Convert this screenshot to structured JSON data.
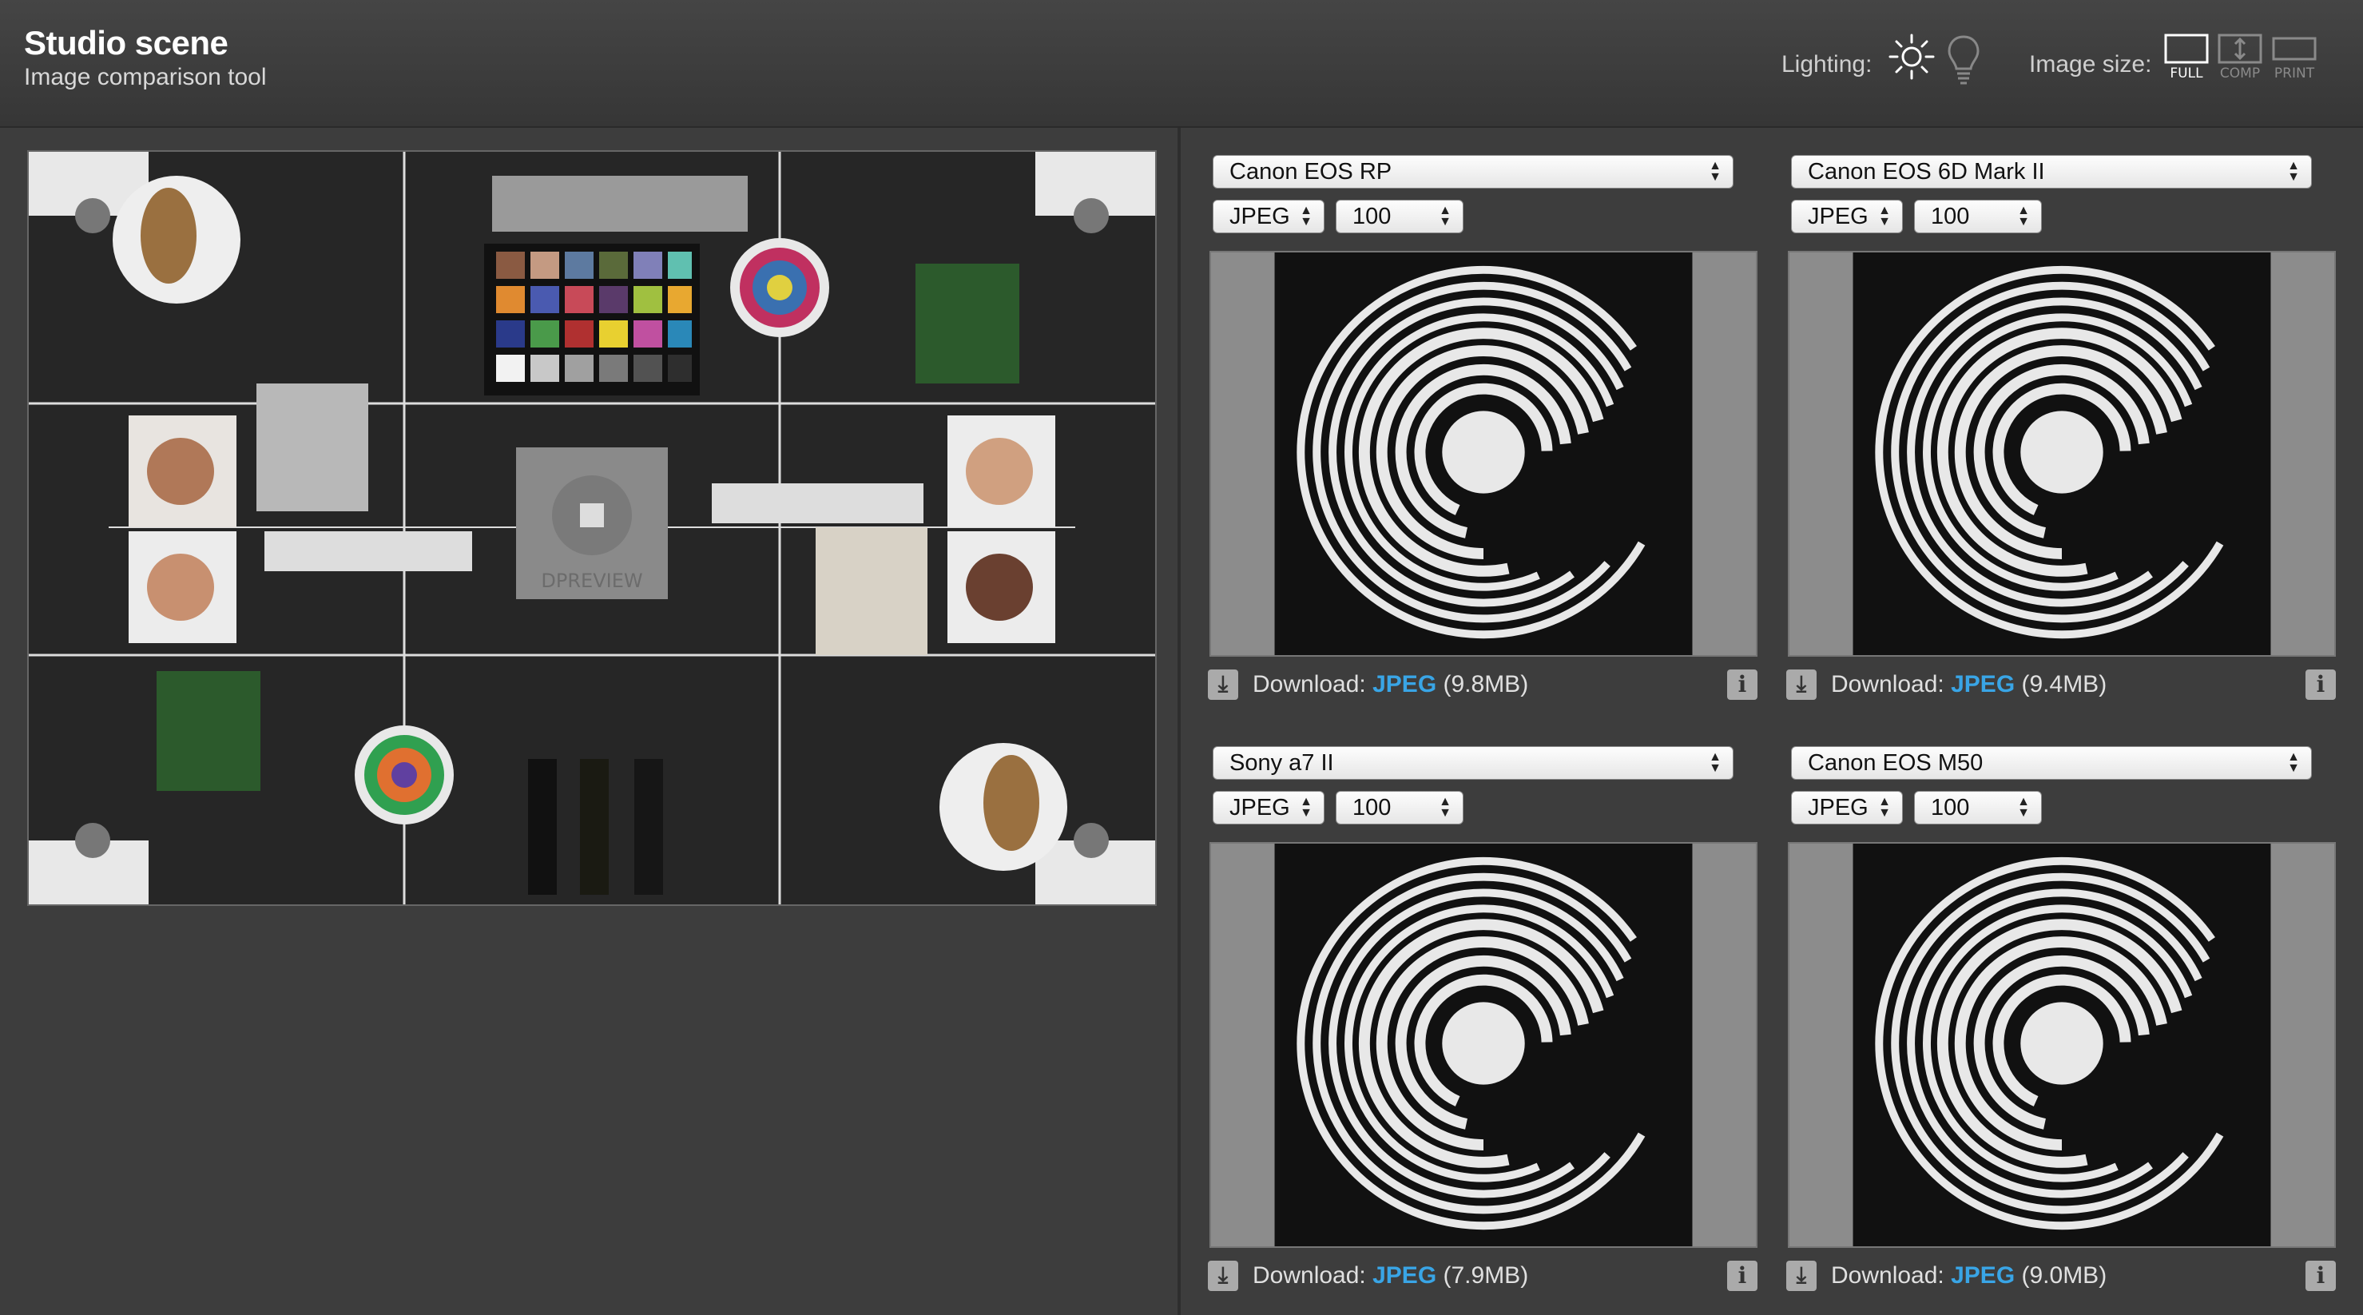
{
  "header": {
    "title": "Studio scene",
    "subtitle": "Image comparison tool",
    "lighting_label": "Lighting:",
    "lighting_options": [
      {
        "icon": "sun-icon",
        "active": true
      },
      {
        "icon": "bulb-icon",
        "active": false
      }
    ],
    "image_size_label": "Image size:",
    "image_size_options": [
      {
        "label": "FULL",
        "active": true
      },
      {
        "label": "COMP",
        "active": false
      },
      {
        "label": "PRINT",
        "active": false
      }
    ]
  },
  "scene": {
    "watermark": "DPREVIEW"
  },
  "panels": [
    {
      "camera": "Canon EOS RP",
      "format": "JPEG",
      "quality": "100",
      "download_label": "Download:",
      "download_format": "JPEG",
      "download_size": "(9.8MB)"
    },
    {
      "camera": "Canon EOS 6D Mark II",
      "format": "JPEG",
      "quality": "100",
      "download_label": "Download:",
      "download_format": "JPEG",
      "download_size": "(9.4MB)"
    },
    {
      "camera": "Sony a7 II",
      "format": "JPEG",
      "quality": "100",
      "download_label": "Download:",
      "download_format": "JPEG",
      "download_size": "(7.9MB)"
    },
    {
      "camera": "Canon EOS M50",
      "format": "JPEG",
      "quality": "100",
      "download_label": "Download:",
      "download_format": "JPEG",
      "download_size": "(9.0MB)"
    }
  ],
  "icons": {
    "download": "download-icon",
    "info": "info-icon",
    "select_arrows": "up-down-arrows-icon"
  },
  "colors": {
    "accent": "#39a5e6",
    "background": "#3d3d3d",
    "header": "#404040"
  }
}
